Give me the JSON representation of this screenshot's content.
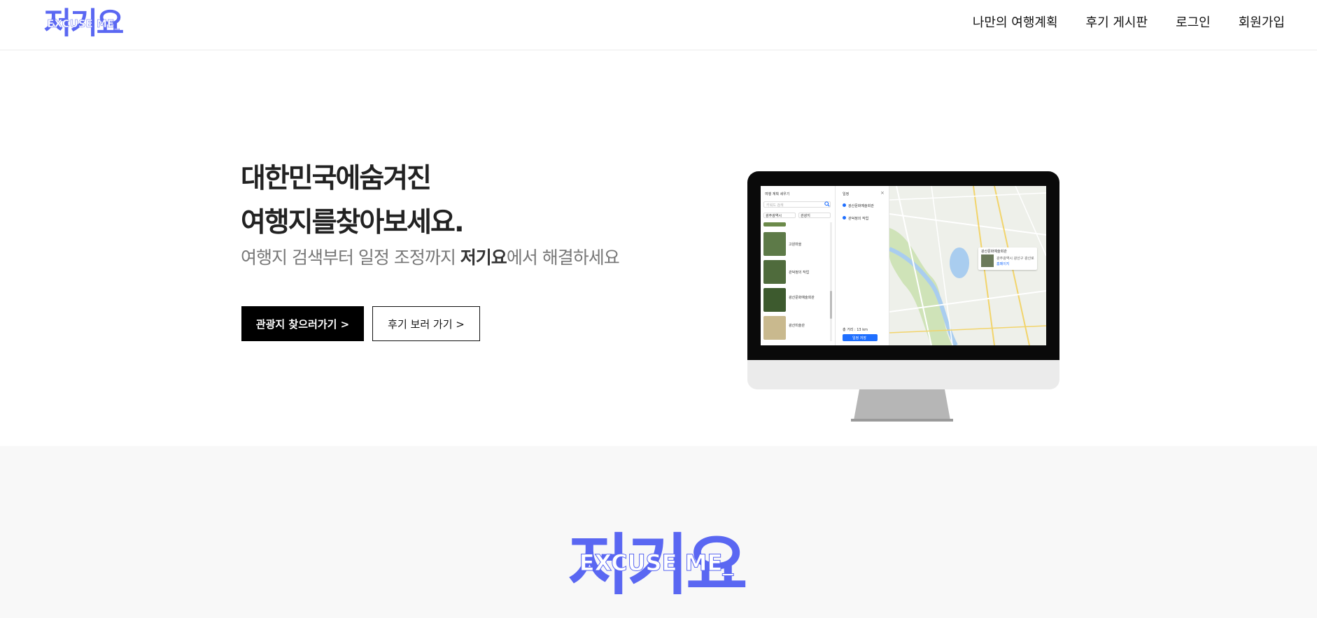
{
  "header": {
    "logo": {
      "korean": "저기요",
      "english": "EXCUSE ME_"
    },
    "nav": [
      {
        "label": "나만의 여행계획"
      },
      {
        "label": "후기 게시판"
      },
      {
        "label": "로그인"
      },
      {
        "label": "회원가입"
      }
    ]
  },
  "hero": {
    "title_line1": "대한민국에숨겨진",
    "title_line2": "여행지를찾아보세요.",
    "subtitle_before": "여행지 검색부터 일정 조정까지 ",
    "subtitle_brand": "저기요",
    "subtitle_after": "에서 해결하세요",
    "primary_button": "관광지 찾으러가기 >",
    "secondary_button": "후기 보러 가기 >"
  },
  "monitor_screen": {
    "left_title": "여행 계획 세우기",
    "search_placeholder": "키워드 검색",
    "select_1": "광주광역시",
    "select_2": "관광지",
    "places": [
      "고원마을",
      "관덕정의 작업",
      "광산문화예술회관",
      "광산미술관"
    ],
    "schedule_title": "일정",
    "schedule_items": [
      "광산문화예술회관",
      "관덕정의 작업"
    ],
    "distance": "총 거리 : 13 km",
    "save_button": "일정 저장",
    "info_title": "광산문화예술회관",
    "info_desc": "광주광역시 광산구 광산로",
    "info_link": "홈페이지"
  },
  "section2": {
    "logo": {
      "korean": "저기요",
      "english": "EXCUSE ME_"
    }
  },
  "colors": {
    "brand_blue": "#5a67f2",
    "black": "#000000",
    "section_bg": "#f8f8f8"
  }
}
